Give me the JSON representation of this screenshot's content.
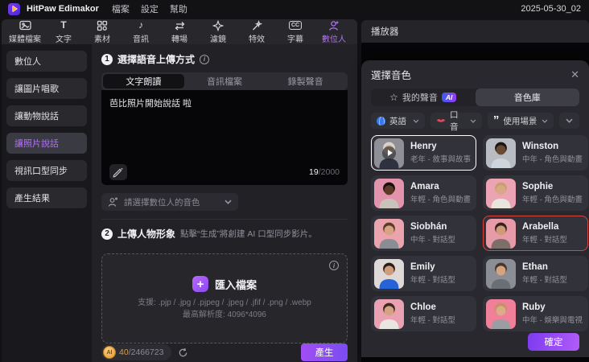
{
  "titlebar": {
    "app_name": "HitPaw Edimakor",
    "menus": [
      "檔案",
      "設定",
      "幫助"
    ],
    "date_label": "2025-05-30_02"
  },
  "toolbar": {
    "items": [
      {
        "label": "媒體檔案",
        "icon": "media-icon",
        "active": false
      },
      {
        "label": "文字",
        "icon": "text-icon",
        "active": false
      },
      {
        "label": "素材",
        "icon": "elements-icon",
        "active": false
      },
      {
        "label": "音訊",
        "icon": "audio-icon",
        "active": false
      },
      {
        "label": "轉場",
        "icon": "transition-icon",
        "active": false
      },
      {
        "label": "濾鏡",
        "icon": "filter-icon",
        "active": false
      },
      {
        "label": "特效",
        "icon": "effects-icon",
        "active": false
      },
      {
        "label": "字幕",
        "icon": "subtitle-icon",
        "active": false
      },
      {
        "label": "數位人",
        "icon": "digital-human-icon",
        "active": true
      }
    ]
  },
  "sidebar": {
    "items": [
      {
        "label": "數位人",
        "active": false
      },
      {
        "label": "讓圖片唱歌",
        "active": false
      },
      {
        "label": "讓動物說話",
        "active": false
      },
      {
        "label": "讓照片說話",
        "active": true
      },
      {
        "label": "視訊口型同步",
        "active": false
      },
      {
        "label": "產生結果",
        "active": false
      }
    ]
  },
  "main": {
    "step1_num": "1",
    "step1_title": "選擇語音上傳方式",
    "tabs": [
      {
        "label": "文字朗讀",
        "active": true
      },
      {
        "label": "音訊檔案",
        "active": false
      },
      {
        "label": "錄製聲音",
        "active": false
      }
    ],
    "text_value": "芭比照片開始說話 啦",
    "char_count": "19",
    "char_limit": "/2000",
    "voice_placeholder": "請選擇數位人的音色",
    "step2_num": "2",
    "step2_title": "上傳人物形象",
    "step2_hint": "點擊“生成”將創建 AI 口型同步影片。",
    "import_label": "匯入檔案",
    "support_line1": "支援: .pjp / .jpg / .pjpeg / .jpeg / .jfif / .png / .webp",
    "support_line2": "最高解析度: 4096*4096",
    "credits_used": "40",
    "credits_total": "/2466723",
    "generate_label": "產生"
  },
  "player": {
    "title": "播放器"
  },
  "voice_panel": {
    "title": "選擇音色",
    "tab_my_voice": "我的聲音",
    "ai_badge": "AI",
    "tab_library": "音色庫",
    "filters": [
      {
        "label": "英語",
        "icon": "globe-icon"
      },
      {
        "label": "口音",
        "icon": "lips-icon"
      },
      {
        "label": "使用場景",
        "icon": "quote-icon"
      }
    ],
    "confirm_label": "確定",
    "voices": [
      {
        "name": "Henry",
        "desc": "老年 - 敘事與故事",
        "selected": true,
        "playing": true,
        "avatar": {
          "bg": "#8f9096",
          "hair": "#d8d4cc",
          "skin": "#caa88e",
          "shirt": "#2e3240"
        }
      },
      {
        "name": "Winston",
        "desc": "中年 - 角色與動畫",
        "selected": false,
        "playing": false,
        "avatar": {
          "bg": "#b9bcc2",
          "hair": "#1c1713",
          "skin": "#6b4a33",
          "shirt": "#cfd4dc"
        }
      },
      {
        "name": "Amara",
        "desc": "年輕 - 角色與動畫",
        "selected": false,
        "playing": false,
        "avatar": {
          "bg": "#e393ab",
          "hair": "#16100c",
          "skin": "#5d3a28",
          "shirt": "#c9c2bb"
        }
      },
      {
        "name": "Sophie",
        "desc": "年輕 - 角色與動畫",
        "selected": false,
        "playing": false,
        "avatar": {
          "bg": "#eba4b4",
          "hair": "#caa06a",
          "skin": "#d9a886",
          "shirt": "#e8e4de"
        }
      },
      {
        "name": "Siobhán",
        "desc": "中年 - 對話型",
        "selected": false,
        "playing": false,
        "avatar": {
          "bg": "#eba4ae",
          "hair": "#5a3b26",
          "skin": "#d8a384",
          "shirt": "#8a8d92"
        }
      },
      {
        "name": "Arabella",
        "desc": "年輕 - 對話型",
        "selected": false,
        "playing": false,
        "highlighted": true,
        "avatar": {
          "bg": "#e79aa8",
          "hair": "#33231a",
          "skin": "#cf9a78",
          "shirt": "#7b6f68"
        }
      },
      {
        "name": "Emily",
        "desc": "年輕 - 對話型",
        "selected": false,
        "playing": false,
        "avatar": {
          "bg": "#ded9d6",
          "hair": "#2a1c14",
          "skin": "#cf9d7e",
          "shirt": "#2563d6"
        }
      },
      {
        "name": "Ethan",
        "desc": "年輕 - 對話型",
        "selected": false,
        "playing": false,
        "avatar": {
          "bg": "#8b8e94",
          "hair": "#4a3526",
          "skin": "#d3a482",
          "shirt": "#6a6e75"
        }
      },
      {
        "name": "Chloe",
        "desc": "年輕 - 對話型",
        "selected": false,
        "playing": false,
        "avatar": {
          "bg": "#eaa2b2",
          "hair": "#3c2a1c",
          "skin": "#d5a284",
          "shirt": "#e9e6e2"
        }
      },
      {
        "name": "Ruby",
        "desc": "中年 - 娛樂與電視",
        "selected": false,
        "playing": false,
        "avatar": {
          "bg": "#f07f9a",
          "hair": "#c29460",
          "skin": "#dcab88",
          "shirt": "#9a9da2"
        }
      }
    ]
  },
  "colors": {
    "accent_purple": "#9a4ff2",
    "active_text_purple": "#b272f6",
    "selected_border": "#ffffff",
    "highlight_red": "#d8443c",
    "coin_gold": "#e09a36"
  },
  "icons": {
    "close": "✕",
    "star": "☆",
    "quote": "”",
    "note": "♪",
    "plus": "+",
    "info": "i",
    "coin_text": "AI",
    "cc": "CC",
    "text_glyph": "T"
  }
}
